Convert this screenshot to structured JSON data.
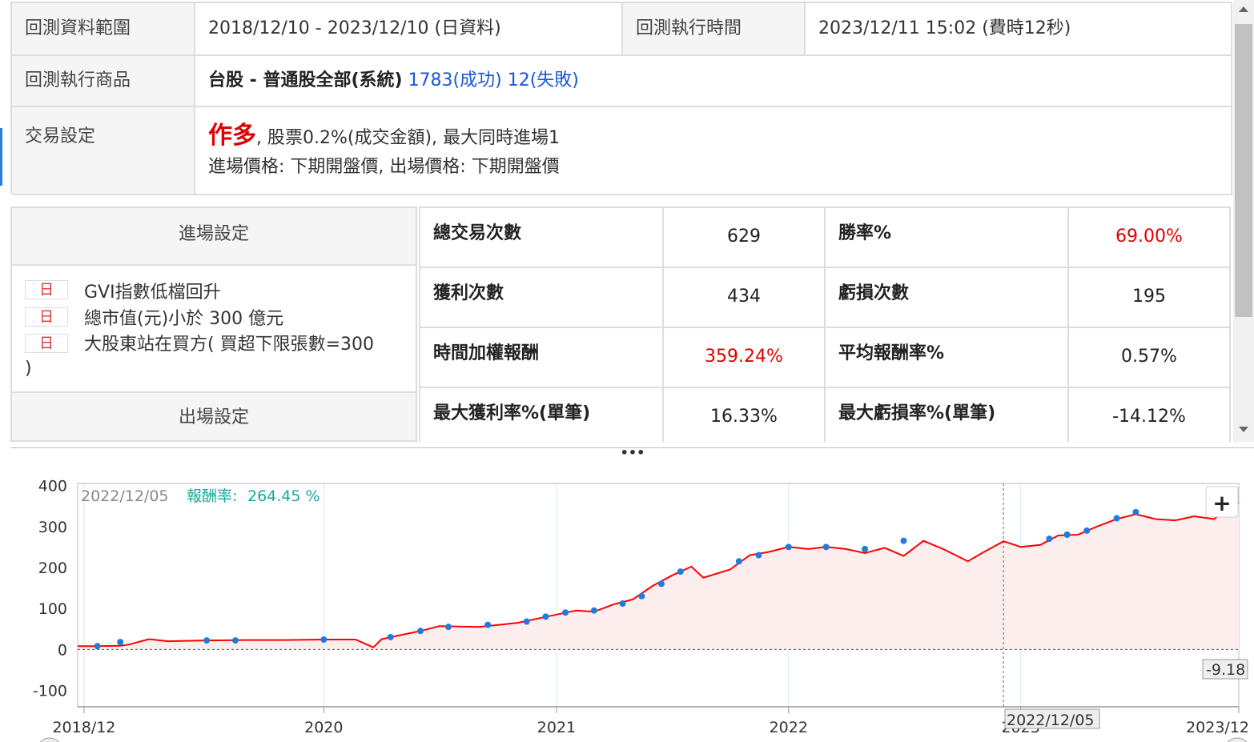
{
  "summary": {
    "range_label": "回測資料範圍",
    "range_value": "2018/12/10 - 2023/12/10 (日資料)",
    "exec_time_label": "回測執行時間",
    "exec_time_value": "2023/12/11 15:02 (費時12秒)",
    "product_label": "回測執行商品",
    "product_value": "台股 - 普通股全部(系統)",
    "product_success": "1783(成功)",
    "product_fail": "12(失敗)",
    "trade_label": "交易設定",
    "trade_direction": "作多",
    "trade_line1_rest": ", 股票0.2%(成交金額), 最大同時進場1",
    "trade_line2": "進場價格: 下期開盤價, 出場價格: 下期開盤價"
  },
  "entry": {
    "title": "進場設定",
    "conditions": [
      {
        "tag": "日",
        "text": "GVI指數低檔回升"
      },
      {
        "tag": "日",
        "text": "總市值(元)小於 300 億元"
      },
      {
        "tag": "日",
        "text": "大股東站在買方( 買超下限張數=300"
      }
    ],
    "wrap_text": ")",
    "exit_title": "出場設定"
  },
  "stats": {
    "total_trades_label": "總交易次數",
    "total_trades": "629",
    "win_rate_label": "勝率%",
    "win_rate": "69.00%",
    "win_count_label": "獲利次數",
    "win_count": "434",
    "loss_count_label": "虧損次數",
    "loss_count": "195",
    "twr_label": "時間加權報酬",
    "twr": "359.24%",
    "avg_return_label": "平均報酬率%",
    "avg_return": "0.57%",
    "max_win_label": "最大獲利率%(單筆)",
    "max_win": "16.33%",
    "max_loss_label": "最大虧損率%(單筆)",
    "max_loss": "-14.12%"
  },
  "splitter": "•••",
  "colors": {
    "accent_red": "#e00000",
    "accent_blue": "#1a56db",
    "line": "#ff0000",
    "marker": "#1e7be0",
    "fill": "#fdeeee",
    "tooltip": "#19a89a"
  },
  "chart_data": {
    "type": "line",
    "series": [
      {
        "name": "報酬率"
      }
    ],
    "tooltip_date": "2022/12/05",
    "tooltip_label": "報酬率:",
    "tooltip_value": "264.45 %",
    "crosshair_date": "2022/12/05",
    "last_value_label": "-9.18",
    "zoom_button": "+",
    "y_ticks": [
      "400",
      "300",
      "200",
      "100",
      "0",
      "-100"
    ],
    "x_ticks": [
      "2018/12",
      "2020",
      "2021",
      "2022",
      "2023",
      "2023/12"
    ],
    "ylim": [
      -140,
      405
    ],
    "points": [
      [
        "2018-12-10",
        8
      ],
      [
        "2019-01-10",
        8
      ],
      [
        "2019-02-15",
        9
      ],
      [
        "2019-03-01",
        12
      ],
      [
        "2019-04-01",
        25
      ],
      [
        "2019-05-01",
        20
      ],
      [
        "2019-07-01",
        22
      ],
      [
        "2019-09-01",
        23
      ],
      [
        "2019-11-01",
        23
      ],
      [
        "2020-01-01",
        24
      ],
      [
        "2020-02-20",
        24
      ],
      [
        "2020-03-19",
        5
      ],
      [
        "2020-04-01",
        25
      ],
      [
        "2020-05-01",
        35
      ],
      [
        "2020-06-01",
        45
      ],
      [
        "2020-07-01",
        57
      ],
      [
        "2020-09-01",
        55
      ],
      [
        "2020-11-01",
        65
      ],
      [
        "2021-01-01",
        85
      ],
      [
        "2021-02-01",
        95
      ],
      [
        "2021-03-01",
        92
      ],
      [
        "2021-04-01",
        110
      ],
      [
        "2021-05-01",
        122
      ],
      [
        "2021-06-01",
        155
      ],
      [
        "2021-07-01",
        180
      ],
      [
        "2021-08-01",
        202
      ],
      [
        "2021-08-20",
        175
      ],
      [
        "2021-10-01",
        195
      ],
      [
        "2021-11-01",
        230
      ],
      [
        "2021-12-01",
        238
      ],
      [
        "2022-01-01",
        250
      ],
      [
        "2022-02-01",
        245
      ],
      [
        "2022-03-01",
        250
      ],
      [
        "2022-04-01",
        245
      ],
      [
        "2022-05-01",
        235
      ],
      [
        "2022-06-01",
        248
      ],
      [
        "2022-07-01",
        228
      ],
      [
        "2022-08-01",
        265
      ],
      [
        "2022-09-01",
        245
      ],
      [
        "2022-10-10",
        215
      ],
      [
        "2022-11-01",
        235
      ],
      [
        "2022-12-05",
        264
      ],
      [
        "2023-01-01",
        250
      ],
      [
        "2023-02-01",
        255
      ],
      [
        "2023-03-01",
        278
      ],
      [
        "2023-04-01",
        280
      ],
      [
        "2023-05-01",
        300
      ],
      [
        "2023-06-01",
        318
      ],
      [
        "2023-07-01",
        330
      ],
      [
        "2023-08-01",
        318
      ],
      [
        "2023-09-01",
        315
      ],
      [
        "2023-10-01",
        325
      ],
      [
        "2023-11-01",
        318
      ],
      [
        "2023-12-10",
        359
      ]
    ],
    "markers": [
      [
        "2019-01-10",
        8
      ],
      [
        "2019-02-15",
        18
      ],
      [
        "2019-07-01",
        22
      ],
      [
        "2019-08-15",
        22
      ],
      [
        "2020-01-01",
        24
      ],
      [
        "2020-04-15",
        30
      ],
      [
        "2020-06-01",
        45
      ],
      [
        "2020-07-15",
        55
      ],
      [
        "2020-09-15",
        60
      ],
      [
        "2020-11-15",
        68
      ],
      [
        "2020-12-15",
        80
      ],
      [
        "2021-01-15",
        90
      ],
      [
        "2021-03-01",
        95
      ],
      [
        "2021-04-15",
        112
      ],
      [
        "2021-05-15",
        130
      ],
      [
        "2021-06-15",
        160
      ],
      [
        "2021-07-15",
        190
      ],
      [
        "2021-10-15",
        215
      ],
      [
        "2021-11-15",
        230
      ],
      [
        "2022-01-01",
        250
      ],
      [
        "2022-03-01",
        250
      ],
      [
        "2022-05-01",
        245
      ],
      [
        "2022-07-01",
        265
      ],
      [
        "2023-02-15",
        270
      ],
      [
        "2023-03-15",
        280
      ],
      [
        "2023-04-15",
        290
      ],
      [
        "2023-06-01",
        320
      ],
      [
        "2023-07-01",
        335
      ],
      [
        "2023-12-01",
        355
      ]
    ]
  }
}
